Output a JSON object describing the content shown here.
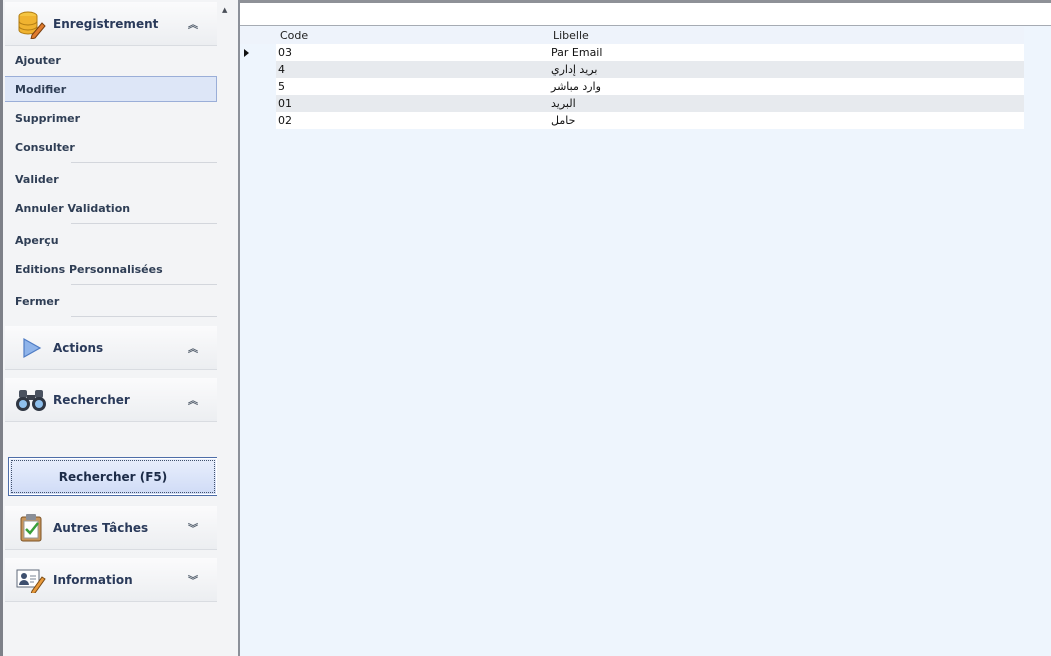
{
  "sidebar": {
    "enregistrement": {
      "title": "Enregistrement",
      "icon": "database-pencil-icon",
      "items": [
        "Ajouter",
        "Modifier",
        "Supprimer",
        "Consulter",
        "Valider",
        "Annuler Validation",
        "Aperçu",
        "Editions Personnalisées",
        "Fermer"
      ],
      "active_item": "Modifier"
    },
    "actions": {
      "title": "Actions",
      "icon": "play-triangle-icon"
    },
    "rechercher": {
      "title": "Rechercher",
      "icon": "binoculars-icon"
    },
    "search_button": "Rechercher (F5)",
    "autres_taches": {
      "title": "Autres Tâches",
      "icon": "clipboard-check-icon"
    },
    "information": {
      "title": "Information",
      "icon": "user-card-icon"
    }
  },
  "grid": {
    "columns": [
      "Code",
      "Libelle"
    ],
    "rows": [
      {
        "code": "03",
        "libelle": "Par Email",
        "current": true
      },
      {
        "code": "4",
        "libelle": "بريد إداري"
      },
      {
        "code": "5",
        "libelle": "وارد مباشر"
      },
      {
        "code": "01",
        "libelle": "البريد"
      },
      {
        "code": "02",
        "libelle": "حامل"
      }
    ]
  },
  "colors": {
    "accent": "#4d6da8",
    "active_item_bg": "#dde6f7",
    "main_bg": "#eef5fd",
    "alt_row": "#e7eaee"
  }
}
